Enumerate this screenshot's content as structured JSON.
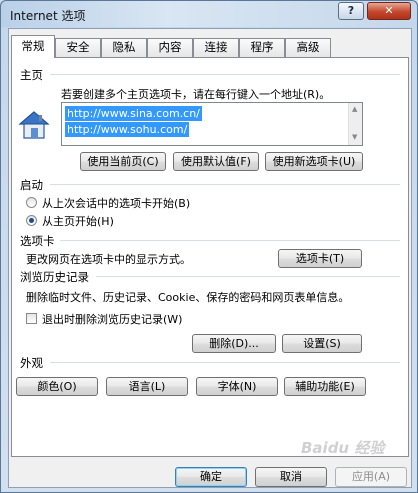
{
  "window": {
    "title": "Internet 选项",
    "help": "?",
    "close": "✕"
  },
  "tabs": [
    "常规",
    "安全",
    "隐私",
    "内容",
    "连接",
    "程序",
    "高级"
  ],
  "home": {
    "title": "主页",
    "description": "若要创建多个主页选项卡，请在每行键入一个地址(R)。",
    "urls": [
      "http://www.sina.com.cn/",
      "http://www.sohu.com/"
    ],
    "btn_current": "使用当前页(C)",
    "btn_default": "使用默认值(F)",
    "btn_newtab": "使用新选项卡(U)"
  },
  "startup": {
    "title": "启动",
    "option_last": "从上次会话中的选项卡开始(B)",
    "option_home": "从主页开始(H)",
    "selected": "option_home"
  },
  "tabs_section": {
    "title": "选项卡",
    "description": "更改网页在选项卡中的显示方式。",
    "btn": "选项卡(T)"
  },
  "history": {
    "title": "浏览历史记录",
    "description": "删除临时文件、历史记录、Cookie、保存的密码和网页表单信息。",
    "checkbox_label": "退出时删除浏览历史记录(W)",
    "checkbox_checked": false,
    "btn_delete": "删除(D)...",
    "btn_settings": "设置(S)"
  },
  "appearance": {
    "title": "外观",
    "btn_colors": "颜色(O)",
    "btn_languages": "语言(L)",
    "btn_fonts": "字体(N)",
    "btn_accessibility": "辅助功能(E)"
  },
  "footer": {
    "ok": "确定",
    "cancel": "取消",
    "apply": "应用(A)"
  },
  "watermark": "Baidu 经验"
}
